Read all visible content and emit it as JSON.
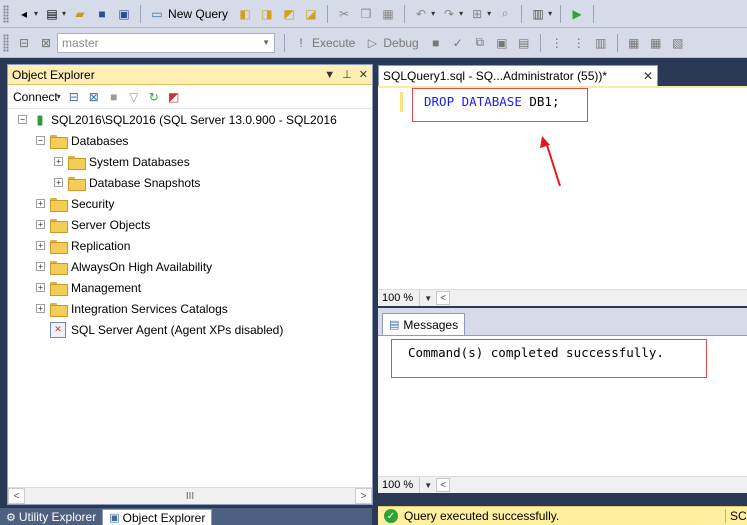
{
  "toolbar1": {
    "new_query_label": "New Query"
  },
  "toolbar2": {
    "database_value": "master",
    "execute_label": "Execute",
    "debug_label": "Debug"
  },
  "object_explorer": {
    "title": "Object Explorer",
    "connect_label": "Connect",
    "tree": {
      "server": "SQL2016\\SQL2016 (SQL Server 13.0.900 - SQL2016",
      "databases": "Databases",
      "system_databases": "System Databases",
      "database_snapshots": "Database Snapshots",
      "security": "Security",
      "server_objects": "Server Objects",
      "replication": "Replication",
      "alwayson": "AlwaysOn High Availability",
      "management": "Management",
      "integration_services": "Integration Services Catalogs",
      "sql_agent": "SQL Server Agent (Agent XPs disabled)"
    },
    "hscroll_thumb": "III"
  },
  "bottom_tabs": {
    "utility_explorer": "Utility Explorer",
    "object_explorer": "Object Explorer"
  },
  "query_tab": {
    "title": "SQLQuery1.sql - SQ...Administrator (55))*"
  },
  "editor": {
    "keyword1": "DROP",
    "keyword2": "DATABASE",
    "rest": " DB1;"
  },
  "zoom": {
    "editor_zoom": "100 %",
    "results_zoom": "100 %"
  },
  "results": {
    "tab_label": "Messages",
    "message": "Command(s) completed successfully."
  },
  "status": {
    "text": "Query executed successfully.",
    "truncated": "SC"
  },
  "colors": {
    "annotation_red": "#e14b4b",
    "selection_blue": "#3399ff",
    "status_yellow": "#ffef9f"
  }
}
